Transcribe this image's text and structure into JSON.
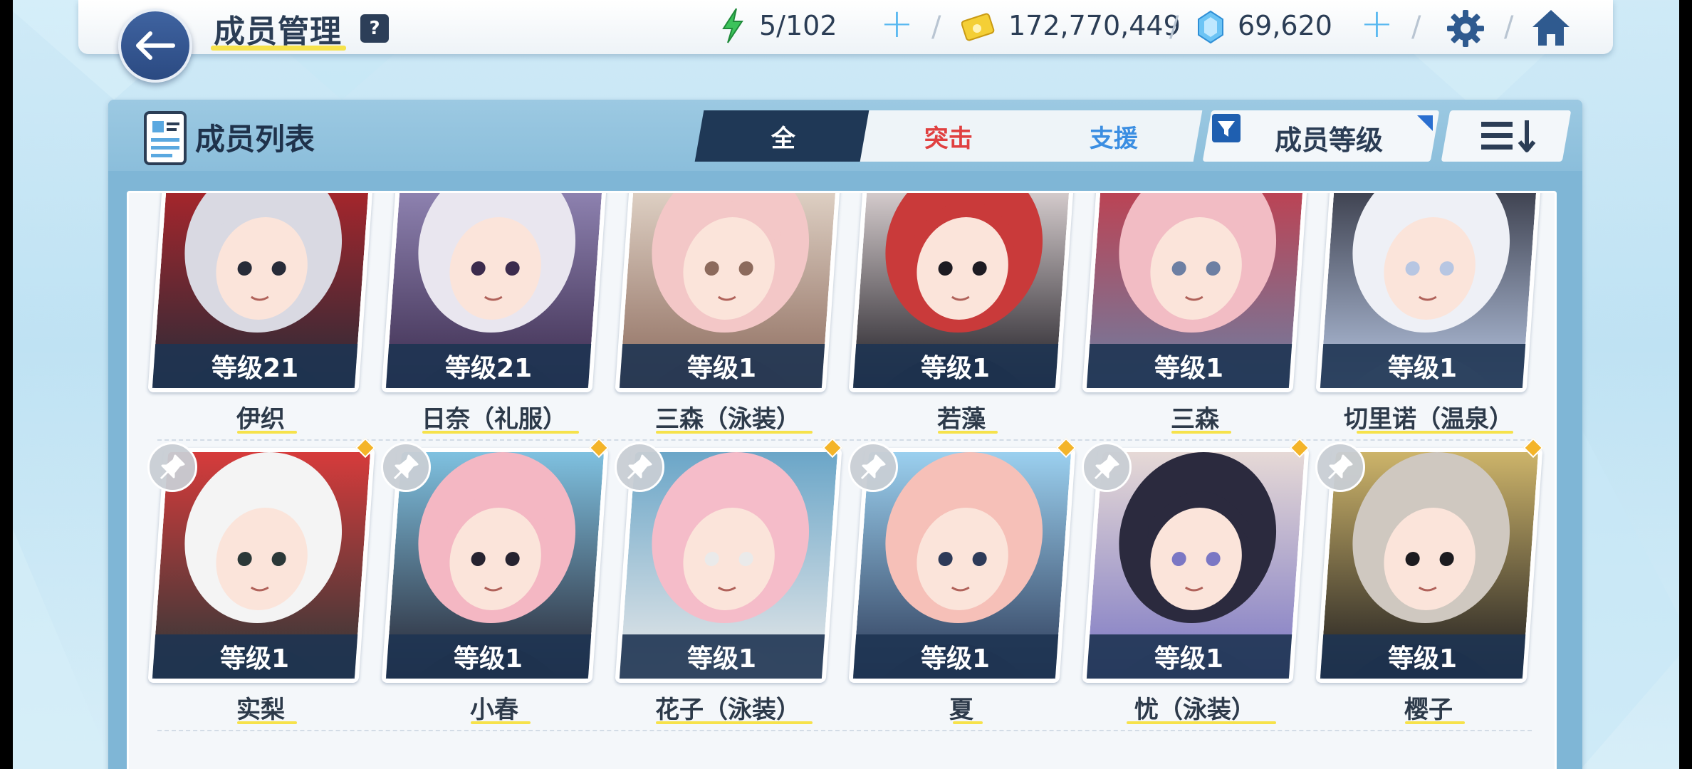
{
  "header": {
    "title": "成员管理",
    "help_label": "?",
    "ap": "5/102",
    "credits": "172,770,449",
    "pyroxene": "69,620"
  },
  "colors": {
    "accent_yellow": "#f6e24b",
    "navy": "#1f3856",
    "striker_red": "#e04040",
    "special_blue": "#3b8ee2",
    "plus_blue": "#58b8f0"
  },
  "list": {
    "title": "成员列表",
    "tabs": [
      {
        "label": "全",
        "active": true
      },
      {
        "label": "突击",
        "active": false
      },
      {
        "label": "支援",
        "active": false
      }
    ],
    "filter_label": "成员等级"
  },
  "students": [
    {
      "name": "伊织",
      "level": "等级21",
      "pinned": false,
      "new": false,
      "palette": [
        "#d9d9e2",
        "#272b38",
        "#b8252a"
      ]
    },
    {
      "name": "日奈（礼服）",
      "level": "等级21",
      "pinned": false,
      "new": false,
      "palette": [
        "#e9e6ef",
        "#3b2b4d",
        "#9a8fbf"
      ]
    },
    {
      "name": "三森（泳装）",
      "level": "等级1",
      "pinned": false,
      "new": false,
      "palette": [
        "#f3c7c7",
        "#8c6a5c",
        "#eadfd3"
      ]
    },
    {
      "name": "若藻",
      "level": "等级1",
      "pinned": false,
      "new": false,
      "palette": [
        "#c93a3a",
        "#1d1b22",
        "#f0e6e6"
      ]
    },
    {
      "name": "三森",
      "level": "等级1",
      "pinned": false,
      "new": false,
      "palette": [
        "#f2bcc4",
        "#6d7fa3",
        "#c73a48"
      ]
    },
    {
      "name": "切里诺（温泉）",
      "level": "等级1",
      "pinned": false,
      "new": false,
      "palette": [
        "#eef0f6",
        "#b7c6e2",
        "#2d2f3b"
      ]
    },
    {
      "name": "实梨",
      "level": "等级1",
      "pinned": true,
      "new": true,
      "palette": [
        "#f4f4f4",
        "#2b3838",
        "#d63b3b"
      ]
    },
    {
      "name": "小春",
      "level": "等级1",
      "pinned": true,
      "new": true,
      "palette": [
        "#f4b7c3",
        "#262330",
        "#7fc1e0"
      ]
    },
    {
      "name": "花子（泳装）",
      "level": "等级1",
      "pinned": true,
      "new": true,
      "palette": [
        "#f5bcc9",
        "#eaeaea",
        "#6ba6c8"
      ]
    },
    {
      "name": "夏",
      "level": "等级1",
      "pinned": true,
      "new": true,
      "palette": [
        "#f6c0b8",
        "#2d3a58",
        "#9bd0ef"
      ]
    },
    {
      "name": "忧（泳装）",
      "level": "等级1",
      "pinned": true,
      "new": true,
      "palette": [
        "#2b2a3e",
        "#7b77c4",
        "#e6d9d6"
      ]
    },
    {
      "name": "樱子",
      "level": "等级1",
      "pinned": true,
      "new": true,
      "palette": [
        "#cfc8c0",
        "#1c1b1f",
        "#cdb46a"
      ]
    }
  ]
}
